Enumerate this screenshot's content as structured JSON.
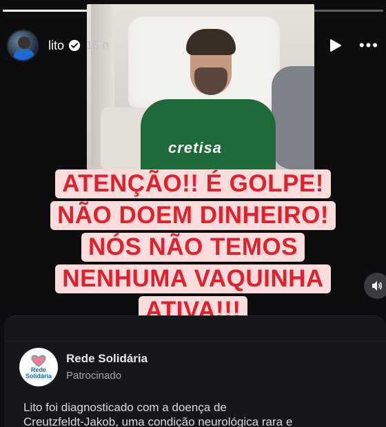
{
  "story": {
    "progress": [
      1.0,
      0.25,
      0.0,
      0.0
    ],
    "username": "lito",
    "time": "15 h",
    "icons": {
      "verified": "verified-badge-icon",
      "play": "play-icon",
      "more": "more-options-icon",
      "volume": "volume-icon"
    }
  },
  "video": {
    "shirt_text": "cretisa"
  },
  "warning": {
    "lines": [
      "ATENÇÃO!! É GOLPE!",
      "NÃO DOEM DINHEIRO!",
      "NÓS NÃO TEMOS",
      "NENHUMA VAQUINHA",
      "ATIVA!!!"
    ]
  },
  "ad": {
    "logo_text_1": "Rede",
    "logo_text_2": "Solidária",
    "name": "Rede Solidária",
    "label": "Patrocinado",
    "text_line_1": "Lito foi diagnosticado com a doença de",
    "text_line_2": "Creutzfeldt-Jakob, uma condição neurológica rara e"
  },
  "colors": {
    "warning_text": "#e0202a",
    "warning_bg": "#fbdcdc",
    "background": "#0d0d10"
  }
}
